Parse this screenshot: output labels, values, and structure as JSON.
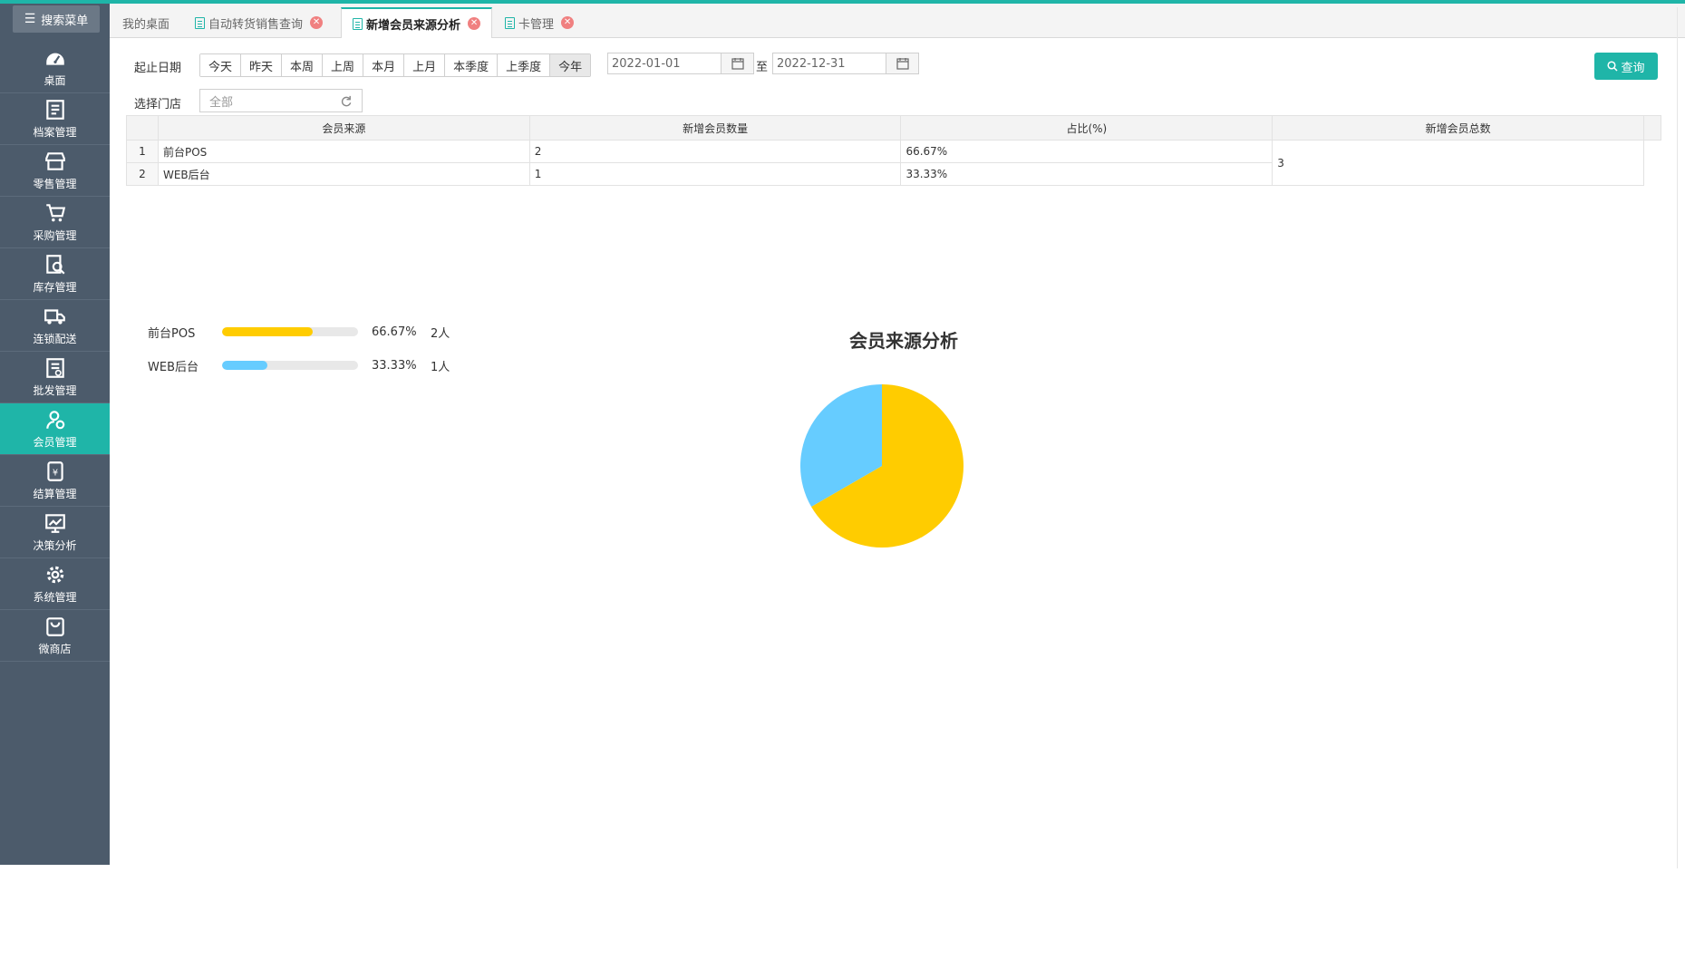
{
  "sidebar": {
    "search_label": "搜索菜单",
    "items": [
      {
        "label": "桌面",
        "icon": "dashboard-icon"
      },
      {
        "label": "档案管理",
        "icon": "archive-icon"
      },
      {
        "label": "零售管理",
        "icon": "store-icon"
      },
      {
        "label": "采购管理",
        "icon": "cart-icon"
      },
      {
        "label": "库存管理",
        "icon": "inventory-icon"
      },
      {
        "label": "连锁配送",
        "icon": "truck-icon"
      },
      {
        "label": "批发管理",
        "icon": "wholesale-icon"
      },
      {
        "label": "会员管理",
        "icon": "member-icon"
      },
      {
        "label": "结算管理",
        "icon": "settlement-icon"
      },
      {
        "label": "决策分析",
        "icon": "analysis-icon"
      },
      {
        "label": "系统管理",
        "icon": "gear-icon"
      },
      {
        "label": "微商店",
        "icon": "shop-bag-icon"
      }
    ],
    "active_index": 7
  },
  "tabs": [
    {
      "label": "我的桌面"
    },
    {
      "label": "自动转货销售查询"
    },
    {
      "label": "新增会员来源分析"
    },
    {
      "label": "卡管理"
    }
  ],
  "filters": {
    "date_label": "起止日期",
    "quick_ranges": [
      "今天",
      "昨天",
      "本周",
      "上周",
      "本月",
      "上月",
      "本季度",
      "上季度",
      "今年"
    ],
    "start_date": "2022-01-01",
    "to_label": "至",
    "end_date": "2022-12-31",
    "store_label": "选择门店",
    "store_placeholder": "全部",
    "query_label": "查询"
  },
  "table": {
    "headers": [
      "会员来源",
      "新增会员数量",
      "占比(%)",
      "新增会员总数"
    ],
    "rows": [
      {
        "index": "1",
        "source": "前台POS",
        "count": "2",
        "pct": "66.67%"
      },
      {
        "index": "2",
        "source": "WEB后台",
        "count": "1",
        "pct": "33.33%"
      }
    ],
    "total": "3"
  },
  "legend_bars": [
    {
      "name": "前台POS",
      "pct": "66.67%",
      "count": "2人",
      "fraction": 0.6667,
      "color": "#ffcc00"
    },
    {
      "name": "WEB后台",
      "pct": "33.33%",
      "count": "1人",
      "fraction": 0.3333,
      "color": "#66ccff"
    }
  ],
  "chart_data": {
    "type": "pie",
    "title": "会员来源分析",
    "categories": [
      "前台POS",
      "WEB后台"
    ],
    "values": [
      2,
      1
    ],
    "colors": [
      "#ffcc00",
      "#66ccff"
    ]
  }
}
